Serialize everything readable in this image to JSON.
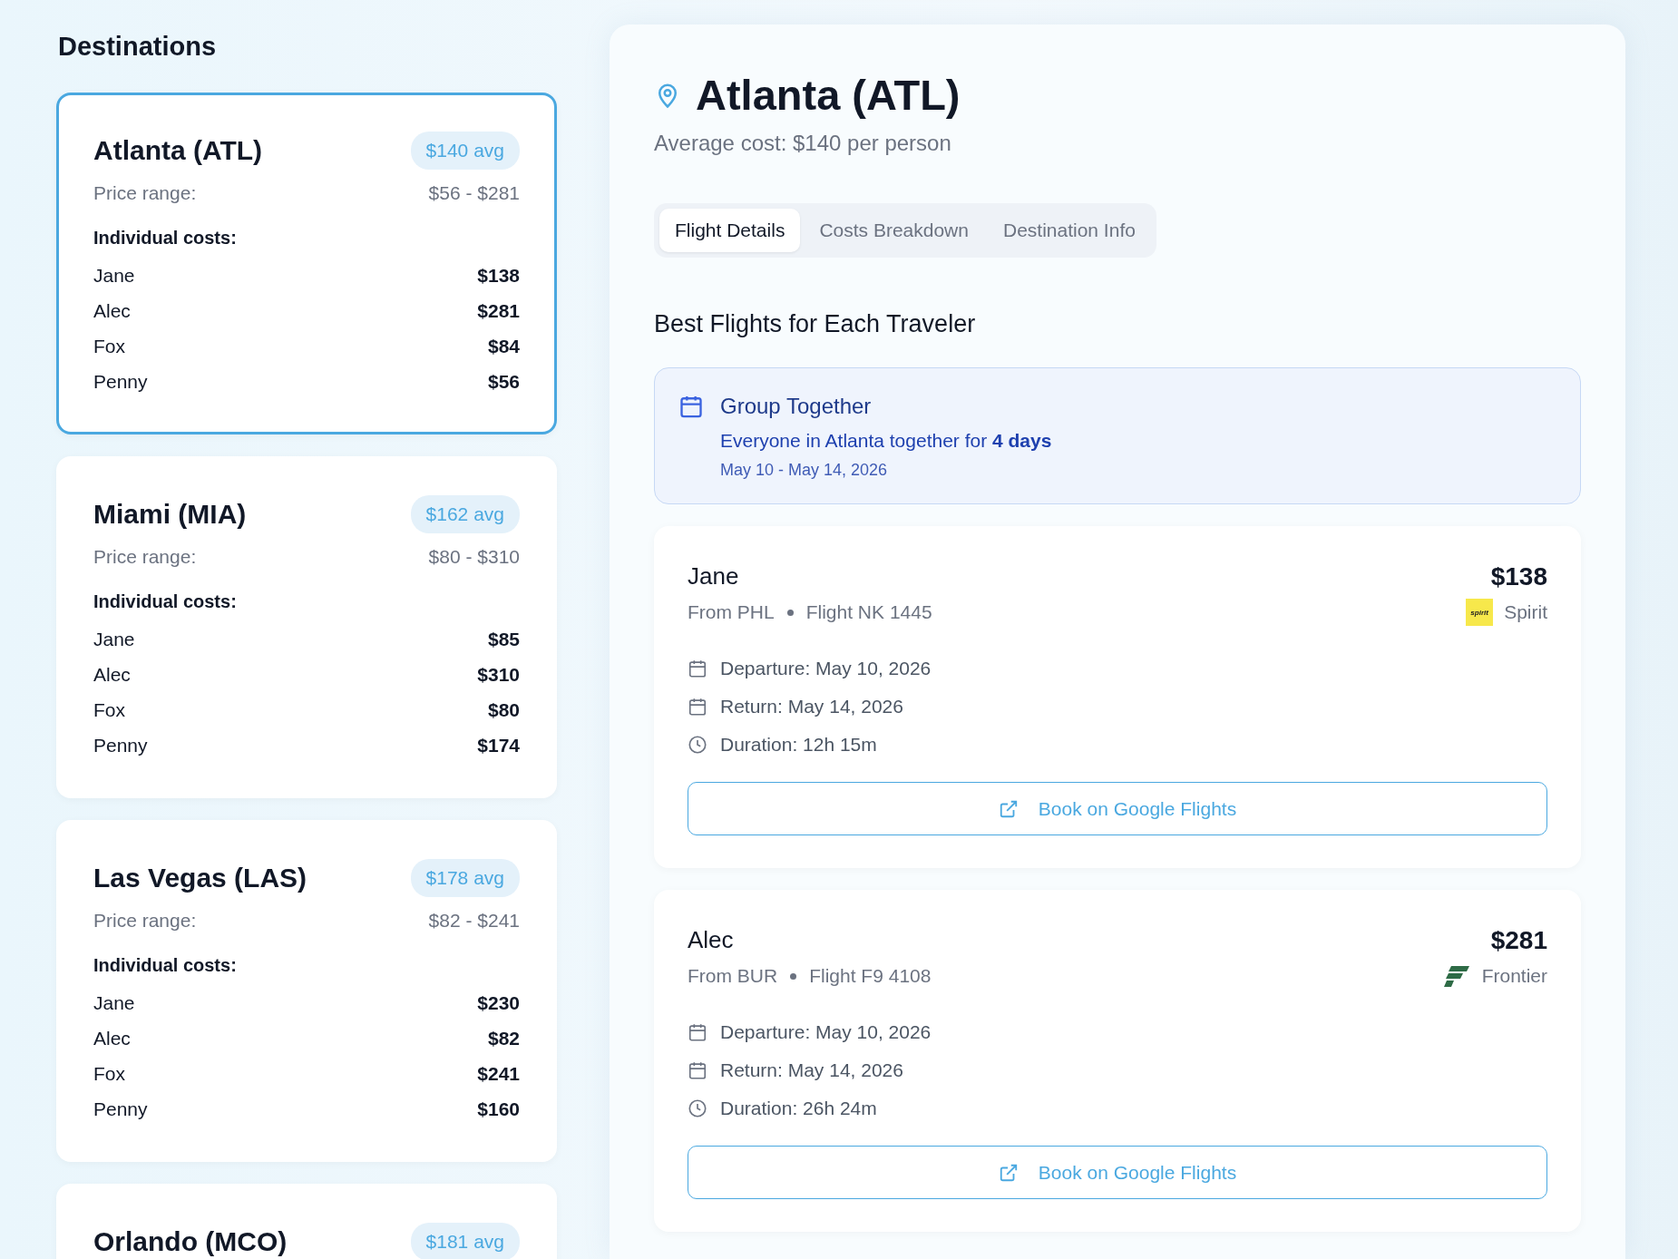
{
  "sidebar": {
    "title": "Destinations",
    "cards": [
      {
        "name": "Atlanta (ATL)",
        "avg": "$140 avg",
        "selected": true,
        "range_label": "Price range:",
        "range": "$56 - $281",
        "costs_label": "Individual costs:",
        "costs": [
          {
            "name": "Jane",
            "cost": "$138"
          },
          {
            "name": "Alec",
            "cost": "$281"
          },
          {
            "name": "Fox",
            "cost": "$84"
          },
          {
            "name": "Penny",
            "cost": "$56"
          }
        ]
      },
      {
        "name": "Miami (MIA)",
        "avg": "$162 avg",
        "selected": false,
        "range_label": "Price range:",
        "range": "$80 - $310",
        "costs_label": "Individual costs:",
        "costs": [
          {
            "name": "Jane",
            "cost": "$85"
          },
          {
            "name": "Alec",
            "cost": "$310"
          },
          {
            "name": "Fox",
            "cost": "$80"
          },
          {
            "name": "Penny",
            "cost": "$174"
          }
        ]
      },
      {
        "name": "Las Vegas (LAS)",
        "avg": "$178 avg",
        "selected": false,
        "range_label": "Price range:",
        "range": "$82 - $241",
        "costs_label": "Individual costs:",
        "costs": [
          {
            "name": "Jane",
            "cost": "$230"
          },
          {
            "name": "Alec",
            "cost": "$82"
          },
          {
            "name": "Fox",
            "cost": "$241"
          },
          {
            "name": "Penny",
            "cost": "$160"
          }
        ]
      },
      {
        "name": "Orlando (MCO)",
        "avg": "$181 avg",
        "selected": false
      }
    ]
  },
  "detail": {
    "title": "Atlanta (ATL)",
    "subtitle": "Average cost: $140 per person",
    "tabs": [
      {
        "label": "Flight Details",
        "selected": true
      },
      {
        "label": "Costs Breakdown",
        "selected": false
      },
      {
        "label": "Destination Info",
        "selected": false
      }
    ],
    "section_title": "Best Flights for Each Traveler",
    "group": {
      "title": "Group Together",
      "text": "Everyone in Atlanta together for **4 days**",
      "dates": "May 10 - May 14, 2026"
    },
    "flights": [
      {
        "traveler": "Jane",
        "from": "From PHL",
        "flight": "Flight NK 1445",
        "price": "$138",
        "airline": "Spirit",
        "kind": "spirit",
        "logo_text": "spirit",
        "departure": "Departure: May 10, 2026",
        "return": "Return: May 14, 2026",
        "duration": "Duration: 12h 15m",
        "button": "Book on Google Flights"
      },
      {
        "traveler": "Alec",
        "from": "From BUR",
        "flight": "Flight F9 4108",
        "price": "$281",
        "airline": "Frontier",
        "kind": "frontier",
        "departure": "Departure: May 10, 2026",
        "return": "Return: May 14, 2026",
        "duration": "Duration: 26h 24m",
        "button": "Book on Google Flights"
      }
    ]
  }
}
